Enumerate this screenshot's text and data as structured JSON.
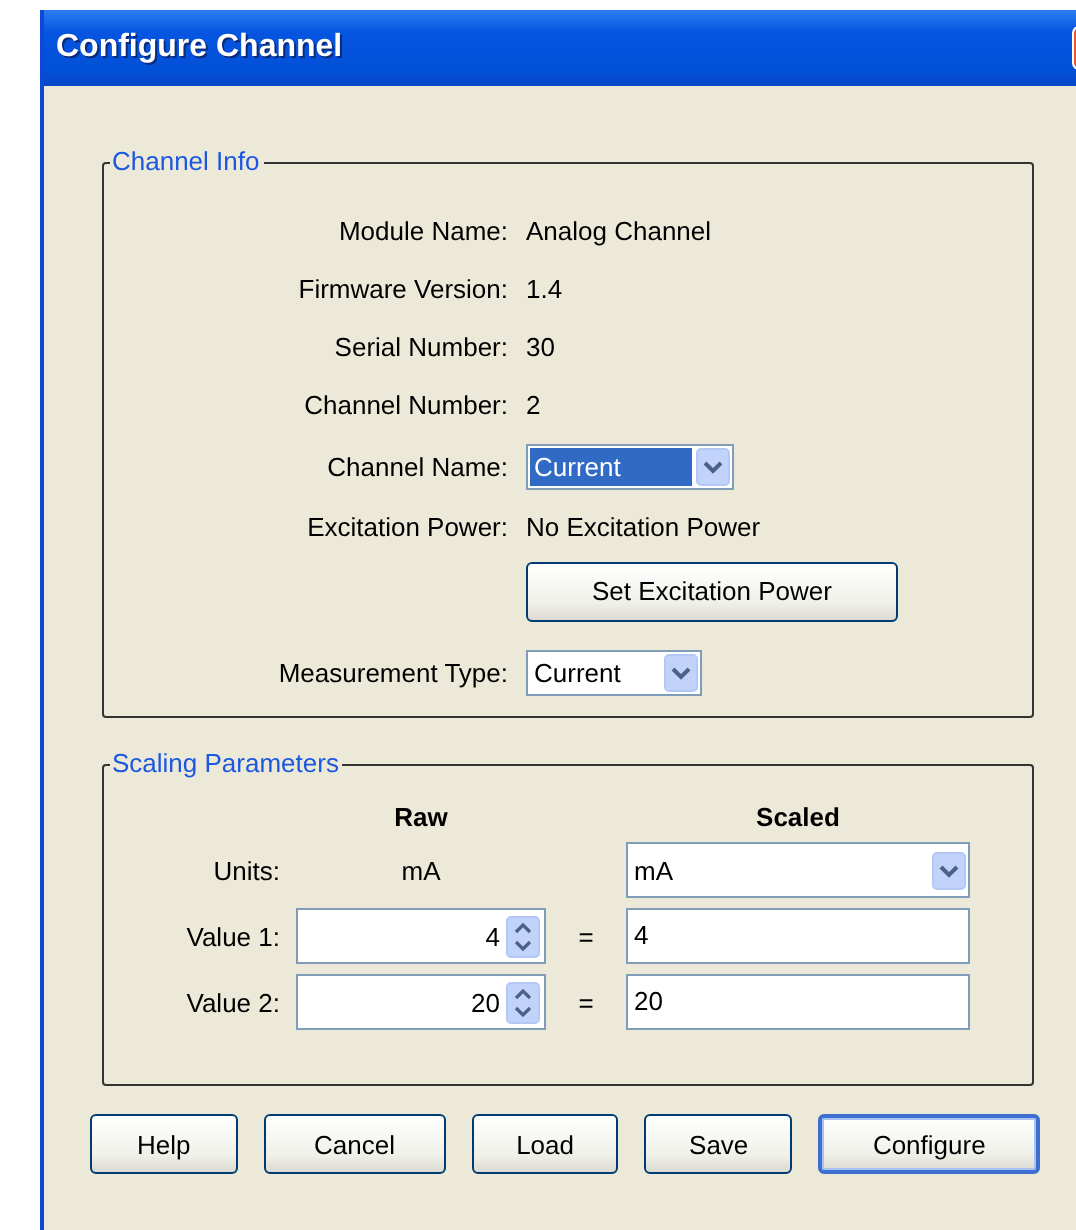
{
  "window": {
    "title": "Configure Channel"
  },
  "channel_info": {
    "title": "Channel Info",
    "rows": [
      {
        "kind": "text",
        "label": "Module Name:",
        "value": "Analog Channel"
      },
      {
        "kind": "text",
        "label": "Firmware Version:",
        "value": "1.4"
      },
      {
        "kind": "text",
        "label": "Serial Number:",
        "value": "30"
      },
      {
        "kind": "text",
        "label": "Channel Number:",
        "value": "2"
      },
      {
        "kind": "dropdown",
        "label": "Channel Name:",
        "value": "Current",
        "focused": true
      },
      {
        "kind": "text",
        "label": "Excitation Power:",
        "value": "No Excitation Power"
      },
      {
        "kind": "button",
        "label": "Set Excitation Power"
      },
      {
        "kind": "dropdown",
        "label": "Measurement Type:",
        "value": "Current",
        "focused": false
      }
    ]
  },
  "scaling": {
    "title": "Scaling Parameters",
    "headers": [
      "Raw",
      "Scaled"
    ],
    "units": {
      "label": "Units:",
      "raw": "mA",
      "scaled": "mA"
    },
    "values": [
      {
        "label": "Value 1:",
        "raw": "4",
        "equals": "=",
        "scaled": "4"
      },
      {
        "label": "Value 2:",
        "raw": "20",
        "equals": "=",
        "scaled": "20"
      }
    ]
  },
  "buttons": [
    {
      "label": "Help",
      "default": false
    },
    {
      "label": "Cancel",
      "default": false
    },
    {
      "label": "Load",
      "default": false
    },
    {
      "label": "Save",
      "default": false
    },
    {
      "label": "Configure",
      "default": true
    }
  ]
}
